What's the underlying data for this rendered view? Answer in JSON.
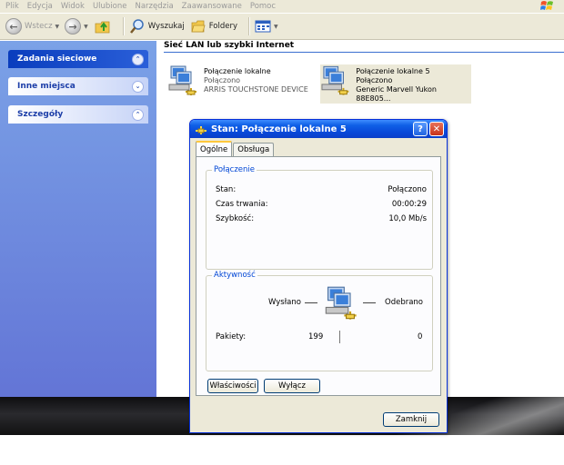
{
  "menu": [
    "Plik",
    "Edycja",
    "Widok",
    "Ulubione",
    "Narzędzia",
    "Zaawansowane",
    "Pomoc"
  ],
  "toolbar": {
    "back_label": "Wstecz",
    "search_label": "Wyszukaj",
    "folders_label": "Foldery"
  },
  "sidebar": {
    "items": [
      {
        "label": "Zadania sieciowe"
      },
      {
        "label": "Inne miejsca"
      },
      {
        "label": "Szczegóły"
      }
    ]
  },
  "content": {
    "group_title": "Sieć LAN lub szybki Internet",
    "connections": [
      {
        "name": "Połączenie lokalne",
        "status": "Połączono",
        "device": "ARRIS TOUCHSTONE DEVICE"
      },
      {
        "name": "Połączenie lokalne 5",
        "status": "Połączono",
        "device": "Generic Marvell Yukon 88E805..."
      }
    ]
  },
  "dialog": {
    "title": "Stan: Połączenie lokalne 5",
    "help": "?",
    "close": "✕",
    "tabs": [
      "Ogólne",
      "Obsługa"
    ],
    "connection_group": "Połączenie",
    "rows": [
      {
        "label": "Stan:",
        "value": "Połączono"
      },
      {
        "label": "Czas trwania:",
        "value": "00:00:29"
      },
      {
        "label": "Szybkość:",
        "value": "10,0 Mb/s"
      }
    ],
    "activity_group": "Aktywność",
    "sent_label": "Wysłano",
    "received_label": "Odebrano",
    "packets_label": "Pakiety:",
    "packets_sent": "199",
    "packets_received": "0",
    "properties_button": "Właściwości",
    "disable_button": "Wyłącz",
    "close_button": "Zamknij"
  },
  "colors": {
    "accent": "#0a3dbd",
    "taskpane": "#6f8ddf",
    "dialog_title": "#0848d8",
    "legend": "#0046d5"
  }
}
